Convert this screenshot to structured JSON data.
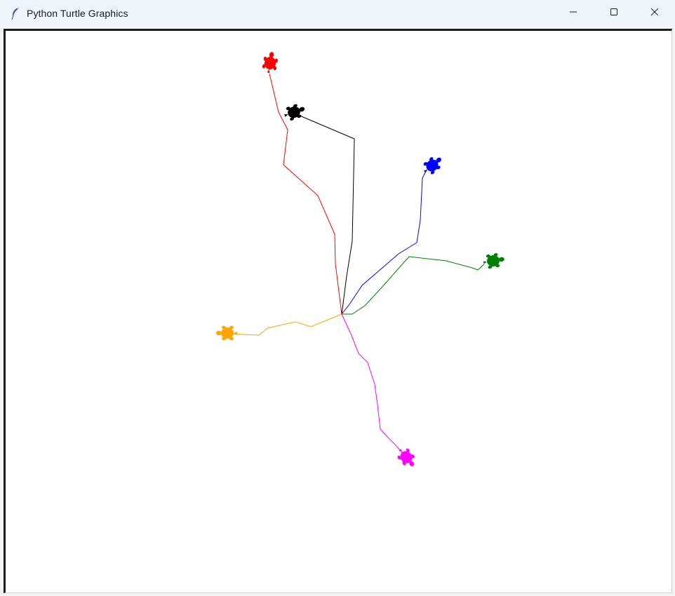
{
  "window": {
    "title": "Python Turtle Graphics",
    "controls": {
      "minimize": "minimize-icon",
      "maximize": "maximize-icon",
      "close": "close-icon"
    }
  },
  "canvas": {
    "background": "#ffffff",
    "turtles": [
      {
        "name": "red",
        "color": "#ff0000",
        "icon": "turtle-icon"
      },
      {
        "name": "black",
        "color": "#000000",
        "icon": "turtle-icon"
      },
      {
        "name": "blue",
        "color": "#0000ff",
        "icon": "turtle-icon"
      },
      {
        "name": "green",
        "color": "#008000",
        "icon": "turtle-icon"
      },
      {
        "name": "orange",
        "color": "#ffa500",
        "icon": "turtle-icon"
      },
      {
        "name": "magenta",
        "color": "#ff00ff",
        "icon": "turtle-icon"
      }
    ]
  }
}
